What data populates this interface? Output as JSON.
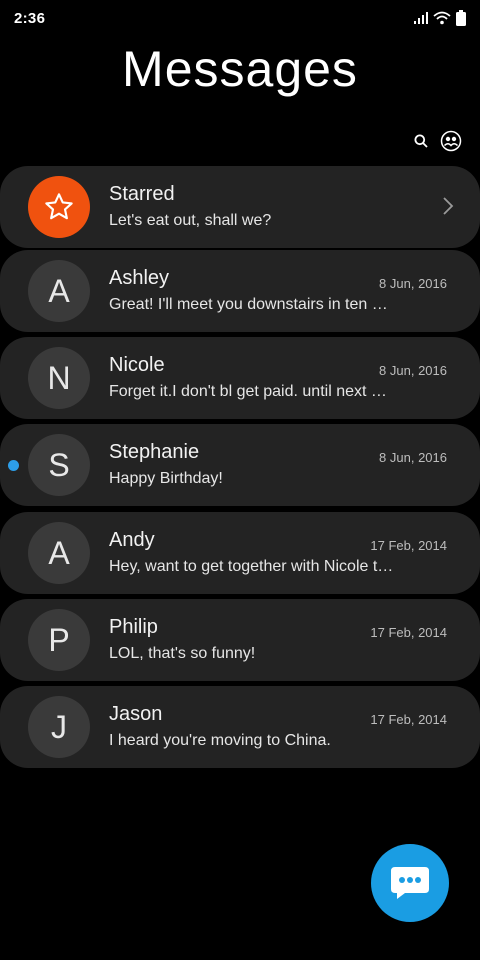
{
  "status_bar": {
    "time": "2:36"
  },
  "header": {
    "title": "Messages"
  },
  "starred": {
    "label": "Starred",
    "preview": "Let's eat out, shall we?"
  },
  "conversations": [
    {
      "initial": "A",
      "name": "Ashley",
      "date": "8 Jun, 2016",
      "preview": "Great! I'll meet you downstairs in ten minutes.",
      "unread": false
    },
    {
      "initial": "N",
      "name": "Nicole",
      "date": "8 Jun, 2016",
      "preview": "Forget it.I don't bl get paid. until next Friday.",
      "unread": false
    },
    {
      "initial": "S",
      "name": "Stephanie",
      "date": "8 Jun, 2016",
      "preview": "Happy Birthday!",
      "unread": true
    },
    {
      "initial": "A",
      "name": "Andy",
      "date": "17 Feb, 2014",
      "preview": "Hey, want to get together with Nicole tonight?",
      "unread": false
    },
    {
      "initial": "P",
      "name": "Philip",
      "date": "17 Feb, 2014",
      "preview": "LOL, that's so funny!",
      "unread": false
    },
    {
      "initial": "J",
      "name": "Jason",
      "date": "17 Feb, 2014",
      "preview": "I heard you're moving to China.",
      "unread": false
    }
  ],
  "colors": {
    "accent": "#1a9de3",
    "starred": "#f0520f",
    "unread_dot": "#2d9ee8",
    "card": "#232323"
  },
  "icons": [
    "search-icon",
    "contacts-icon",
    "star-icon",
    "chevron-right-icon",
    "chat-icon"
  ]
}
